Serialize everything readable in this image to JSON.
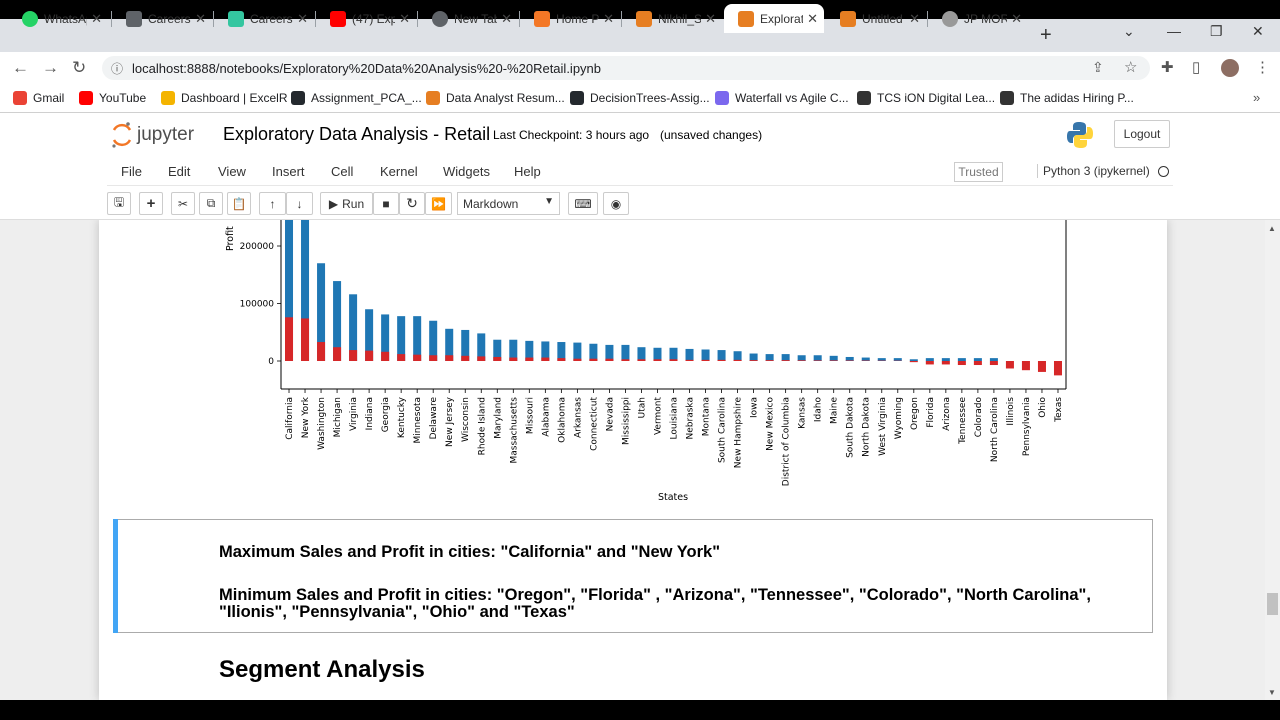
{
  "browser": {
    "tabs": [
      {
        "label": "WhatsAp",
        "icon": "whatsapp-icon",
        "color": "#25d366"
      },
      {
        "label": "Careers",
        "icon": "careers-icon",
        "color": "#5f6368"
      },
      {
        "label": "Careers",
        "icon": "leaf-icon",
        "color": "#34c6a0"
      },
      {
        "label": "(47) Expl",
        "icon": "youtube-icon",
        "color": "#ff0000"
      },
      {
        "label": "New Tab",
        "icon": "chrome-icon",
        "color": "#5f6368"
      },
      {
        "label": "Home Pa",
        "icon": "jupyter-icon",
        "color": "#f37726"
      },
      {
        "label": "Nikhil_Sa",
        "icon": "notebook-icon",
        "color": "#e67e22"
      },
      {
        "label": "Explorat",
        "icon": "notebook-icon",
        "color": "#e67e22"
      },
      {
        "label": "Untitled",
        "icon": "notebook-icon",
        "color": "#e67e22"
      },
      {
        "label": "JP MORG",
        "icon": "jpmorgan-icon",
        "color": "#999999"
      }
    ],
    "url": "localhost:8888/notebooks/Exploratory%20Data%20Analysis%20-%20Retail.ipynb",
    "bookmarks": [
      {
        "label": "Gmail",
        "icon": "gmail-icon",
        "color": "#ea4335"
      },
      {
        "label": "YouTube",
        "icon": "youtube-icon",
        "color": "#ff0000"
      },
      {
        "label": "Dashboard | ExcelR",
        "icon": "excelr-icon",
        "color": "#f4b400"
      },
      {
        "label": "Assignment_PCA_...",
        "icon": "github-icon",
        "color": "#24292e"
      },
      {
        "label": "Data Analyst Resum...",
        "icon": "chart-icon",
        "color": "#e67e22"
      },
      {
        "label": "DecisionTrees-Assig...",
        "icon": "github-icon",
        "color": "#24292e"
      },
      {
        "label": "Waterfall vs Agile C...",
        "icon": "diamond-icon",
        "color": "#7b68ee"
      },
      {
        "label": "TCS iON Digital Lea...",
        "icon": "tcs-icon",
        "color": "#333333"
      },
      {
        "label": "The adidas Hiring P...",
        "icon": "globe-icon",
        "color": "#333333"
      }
    ]
  },
  "jupyter": {
    "logo_text": "jupyter",
    "title": "Exploratory Data Analysis - Retail",
    "checkpoint": "Last Checkpoint: 3 hours ago",
    "unsaved": "(unsaved changes)",
    "logout": "Logout",
    "menu": [
      "File",
      "Edit",
      "View",
      "Insert",
      "Cell",
      "Kernel",
      "Widgets",
      "Help"
    ],
    "trusted": "Trusted",
    "kernel": "Python 3 (ipykernel)",
    "run_label": "Run",
    "cell_type": "Markdown"
  },
  "chart_data": {
    "type": "bar",
    "stacked": true,
    "xlabel": "States",
    "ylabel": "Profit",
    "ytick_labels": [
      "0",
      "100000",
      "200000"
    ],
    "yticks": [
      0,
      100000,
      200000
    ],
    "ylim": [
      -50000,
      250000
    ],
    "grid": false,
    "categories": [
      "California",
      "New York",
      "Washington",
      "Michigan",
      "Virginia",
      "Indiana",
      "Georgia",
      "Kentucky",
      "Minnesota",
      "Delaware",
      "New Jersey",
      "Wisconsin",
      "Rhode Island",
      "Maryland",
      "Massachusetts",
      "Missouri",
      "Alabama",
      "Oklahoma",
      "Arkansas",
      "Connecticut",
      "Nevada",
      "Mississippi",
      "Utah",
      "Vermont",
      "Louisiana",
      "Nebraska",
      "Montana",
      "South Carolina",
      "New Hampshire",
      "Iowa",
      "New Mexico",
      "District of Columbia",
      "Kansas",
      "Idaho",
      "Maine",
      "South Dakota",
      "North Dakota",
      "West Virginia",
      "Wyoming",
      "Oregon",
      "Florida",
      "Arizona",
      "Tennessee",
      "Colorado",
      "North Carolina",
      "Illinois",
      "Pennsylvania",
      "Ohio",
      "Texas"
    ],
    "series": [
      {
        "color": "#1f77b4",
        "values": [
          250000,
          250000,
          170000,
          139000,
          116000,
          90000,
          81000,
          78000,
          78000,
          70000,
          56000,
          54000,
          48000,
          37000,
          37000,
          35000,
          34000,
          33000,
          32000,
          30000,
          28000,
          28000,
          24000,
          23000,
          23000,
          21000,
          20000,
          19000,
          17000,
          13000,
          12000,
          12000,
          10000,
          10000,
          9000,
          7000,
          6000,
          5000,
          5000,
          3000,
          5000,
          5000,
          5000,
          5000,
          5000,
          0,
          0,
          0,
          0
        ]
      },
      {
        "color": "#d62728",
        "values": [
          76000,
          74000,
          33000,
          24000,
          19000,
          18000,
          16000,
          12000,
          11000,
          10000,
          10000,
          9000,
          8000,
          7000,
          6000,
          6000,
          6000,
          5000,
          4000,
          4000,
          4000,
          3000,
          3000,
          3000,
          3000,
          2000,
          2000,
          2000,
          2000,
          1500,
          1500,
          1500,
          1200,
          1000,
          1000,
          900,
          800,
          700,
          600,
          -2000,
          -6000,
          -6000,
          -7000,
          -7000,
          -7000,
          -13000,
          -16000,
          -19000,
          -25000
        ]
      }
    ]
  },
  "markdown": {
    "line1": "Maximum Sales and Profit in cities: \"California\" and \"New York\"",
    "line2": "Minimum Sales and Profit in cities: \"Oregon\", \"Florida\" , \"Arizona\", \"Tennessee\", \"Colorado\", \"North Carolina\",",
    "line3": "\"Ilionis\", \"Pennsylvania\", \"Ohio\" and \"Texas\"",
    "heading": "Segment Analysis"
  }
}
